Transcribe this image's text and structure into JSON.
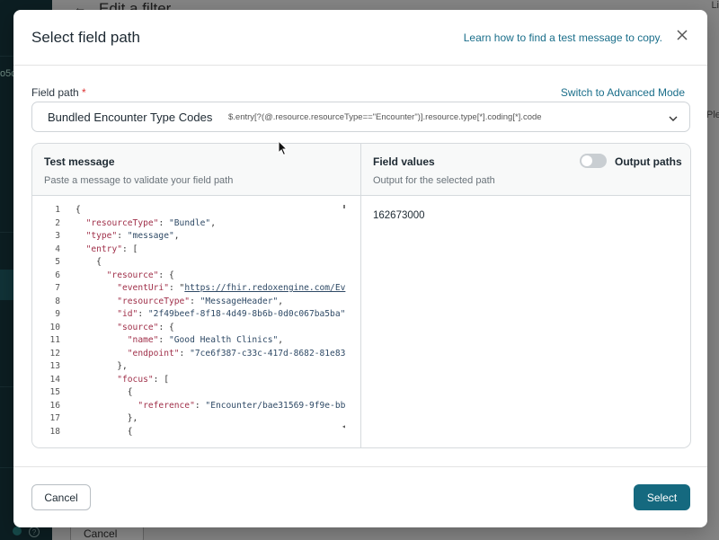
{
  "background": {
    "page_title": "Edit a filter",
    "back_icon": "arrow-left-icon",
    "cancel_label": "Cancel",
    "right_text_top": "Li",
    "right_text_mid": "Ple",
    "left_text": "o5c"
  },
  "modal": {
    "title": "Select field path",
    "learn_link": "Learn how to find a test message to copy.",
    "close_icon": "close-icon"
  },
  "field_path": {
    "label": "Field path",
    "required_mark": "*",
    "advanced_link": "Switch to Advanced Mode",
    "selected_name": "Bundled Encounter Type Codes",
    "selected_path": "$.entry[?(@.resource.resourceType==\"Encounter\")].resource.type[*].coding[*].code"
  },
  "test_message": {
    "title": "Test message",
    "subtitle": "Paste a message to validate your field path"
  },
  "field_values": {
    "title": "Field values",
    "subtitle": "Output for the selected path",
    "toggle_label": "Output paths",
    "toggle_on": false,
    "value": "162673000"
  },
  "code_lines": [
    {
      "n": "1",
      "t": "{"
    },
    {
      "n": "2",
      "t": "  \"resourceType\": \"Bundle\","
    },
    {
      "n": "3",
      "t": "  \"type\": \"message\","
    },
    {
      "n": "4",
      "t": "  \"entry\": ["
    },
    {
      "n": "5",
      "t": "    {"
    },
    {
      "n": "6",
      "t": "      \"resource\": {"
    },
    {
      "n": "7",
      "t": "        \"eventUri\": \"https://fhir.redoxengine.com/Ev"
    },
    {
      "n": "8",
      "t": "        \"resourceType\": \"MessageHeader\","
    },
    {
      "n": "9",
      "t": "        \"id\": \"2f49beef-8f18-4d49-8b6b-0d0c067ba5ba\""
    },
    {
      "n": "10",
      "t": "        \"source\": {"
    },
    {
      "n": "11",
      "t": "          \"name\": \"Good Health Clinics\","
    },
    {
      "n": "12",
      "t": "          \"endpoint\": \"7ce6f387-c33c-417d-8682-81e83"
    },
    {
      "n": "13",
      "t": "        },"
    },
    {
      "n": "14",
      "t": "        \"focus\": ["
    },
    {
      "n": "15",
      "t": "          {"
    },
    {
      "n": "16",
      "t": "            \"reference\": \"Encounter/bae31569-9f9e-bb"
    },
    {
      "n": "17",
      "t": "          },"
    },
    {
      "n": "18",
      "t": "          {"
    }
  ],
  "footer": {
    "cancel_label": "Cancel",
    "select_label": "Select"
  },
  "colors": {
    "primary": "#15697f",
    "link": "#1a6e8a",
    "required": "#d33"
  }
}
